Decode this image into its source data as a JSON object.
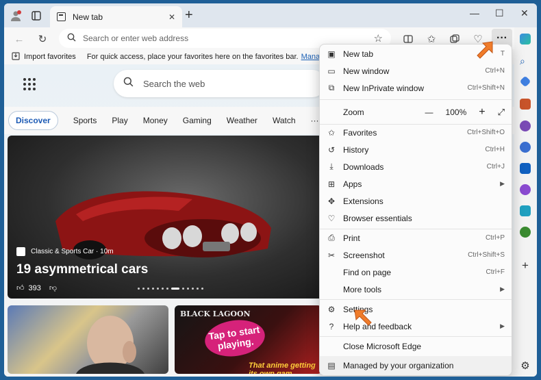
{
  "tab": {
    "title": "New tab"
  },
  "address": {
    "placeholder": "Search or enter web address"
  },
  "favorites_bar": {
    "import_label": "Import favorites",
    "message": "For quick access, place your favorites here on the favorites bar.",
    "link": "Manage favorites"
  },
  "page": {
    "search_placeholder": "Search the web",
    "feed_tabs": [
      "Discover",
      "Sports",
      "Play",
      "Money",
      "Gaming",
      "Weather",
      "Watch"
    ],
    "more": "···",
    "hero": {
      "source": "Classic & Sports Car · 10m",
      "headline": "19 asymmetrical cars",
      "likes": "393"
    },
    "card2": {
      "title": "BLACK LAGOON",
      "bubble": "Tap to start playing.",
      "caption": "That anime getting its own gam"
    }
  },
  "menu": {
    "items": {
      "new_tab": {
        "label": "New tab",
        "shortcut": "T"
      },
      "new_window": {
        "label": "New window",
        "shortcut": "Ctrl+N"
      },
      "new_inprivate": {
        "label": "New InPrivate window",
        "shortcut": "Ctrl+Shift+N"
      },
      "zoom": {
        "label": "Zoom",
        "minus": "—",
        "value": "100%",
        "plus": "+"
      },
      "favorites": {
        "label": "Favorites",
        "shortcut": "Ctrl+Shift+O"
      },
      "history": {
        "label": "History",
        "shortcut": "Ctrl+H"
      },
      "downloads": {
        "label": "Downloads",
        "shortcut": "Ctrl+J"
      },
      "apps": {
        "label": "Apps"
      },
      "extensions": {
        "label": "Extensions"
      },
      "browser_essentials": {
        "label": "Browser essentials"
      },
      "print": {
        "label": "Print",
        "shortcut": "Ctrl+P"
      },
      "screenshot": {
        "label": "Screenshot",
        "shortcut": "Ctrl+Shift+S"
      },
      "find_on_page": {
        "label": "Find on page",
        "shortcut": "Ctrl+F"
      },
      "more_tools": {
        "label": "More tools"
      },
      "settings": {
        "label": "Settings"
      },
      "help_feedback": {
        "label": "Help and feedback"
      },
      "close_edge": {
        "label": "Close Microsoft Edge"
      },
      "managed": {
        "label": "Managed by your organization"
      }
    }
  },
  "colors": {
    "accent": "#1d5bb5",
    "arrow": "#f07c2a",
    "titlebar": "#dfe6ee"
  }
}
